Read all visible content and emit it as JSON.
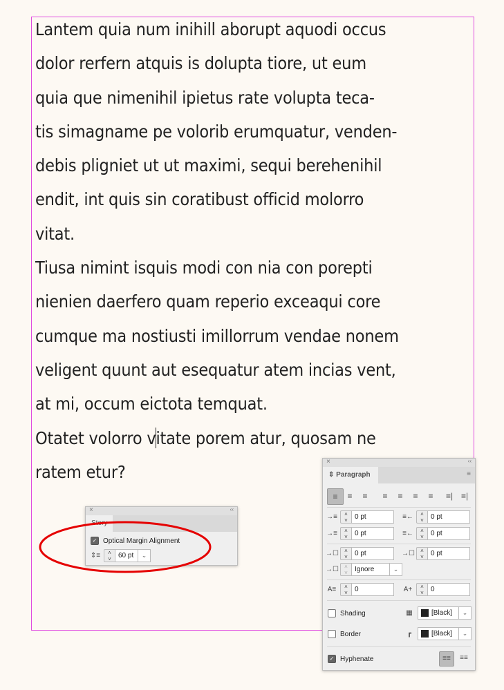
{
  "body_text": {
    "lines": [
      "Lantem quia num inihill aborupt aquodi occus",
      "dolor rerfern atquis is dolupta tiore, ut eum",
      "quia que nimenihil ipietus rate volupta teca-",
      "tis simagname pe volorib erumquatur, venden-",
      "debis pligniet ut ut maximi, sequi berehenihil",
      "endit, int quis sin coratibust officid molorro",
      "vitat.",
      "Tiusa nimint isquis modi con nia con porepti",
      "nienien daerfero quam reperio exceaqui core",
      "cumque ma nostiusti imillorrum vendae nonem",
      "veligent quunt aut esequatur atem incias vent,",
      "at mi, occum eictota temquat."
    ],
    "cursor_line_before": "Otatet volorro v",
    "cursor_line_after": "itate porem atur, quosam ne",
    "last_line": "ratem etur?"
  },
  "colors": {
    "frame": "#e04be0",
    "annotation": "#e50000",
    "background": "#fdf9f3"
  },
  "story_panel": {
    "close": "×",
    "collapse": "‹‹",
    "tab": "Story",
    "optical_margin_label": "Optical Margin Alignment",
    "optical_margin_checked": true,
    "size_value": "60 pt"
  },
  "paragraph_panel": {
    "close": "×",
    "collapse": "‹‹",
    "tab": "Paragraph",
    "left_indent": "0 pt",
    "right_indent": "0 pt",
    "first_line_indent": "0 pt",
    "last_line_indent": "0 pt",
    "space_before": "0 pt",
    "space_after": "0 pt",
    "align_to_grid": "Ignore",
    "drop_cap_lines": "0",
    "drop_cap_chars": "0",
    "shading_label": "Shading",
    "shading_color": "[Black]",
    "shading_checked": false,
    "border_label": "Border",
    "border_color": "[Black]",
    "border_checked": false,
    "hyphenate_label": "Hyphenate",
    "hyphenate_checked": true
  }
}
